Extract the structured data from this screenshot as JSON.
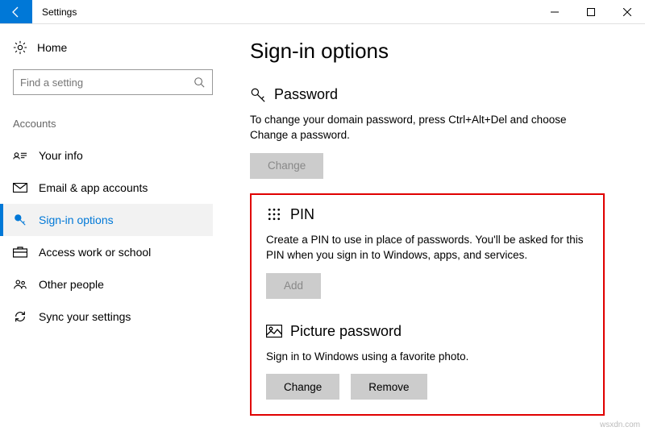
{
  "window": {
    "title": "Settings"
  },
  "sidebar": {
    "home_label": "Home",
    "search_placeholder": "Find a setting",
    "category": "Accounts",
    "items": [
      {
        "label": "Your info"
      },
      {
        "label": "Email & app accounts"
      },
      {
        "label": "Sign-in options"
      },
      {
        "label": "Access work or school"
      },
      {
        "label": "Other people"
      },
      {
        "label": "Sync your settings"
      }
    ]
  },
  "main": {
    "title": "Sign-in options",
    "password": {
      "heading": "Password",
      "desc": "To change your domain password, press Ctrl+Alt+Del and choose Change a password.",
      "change_label": "Change"
    },
    "pin": {
      "heading": "PIN",
      "desc": "Create a PIN to use in place of passwords. You'll be asked for this PIN when you sign in to Windows, apps, and services.",
      "add_label": "Add"
    },
    "picture": {
      "heading": "Picture password",
      "desc": "Sign in to Windows using a favorite photo.",
      "change_label": "Change",
      "remove_label": "Remove"
    }
  },
  "watermark": "wsxdn.com"
}
